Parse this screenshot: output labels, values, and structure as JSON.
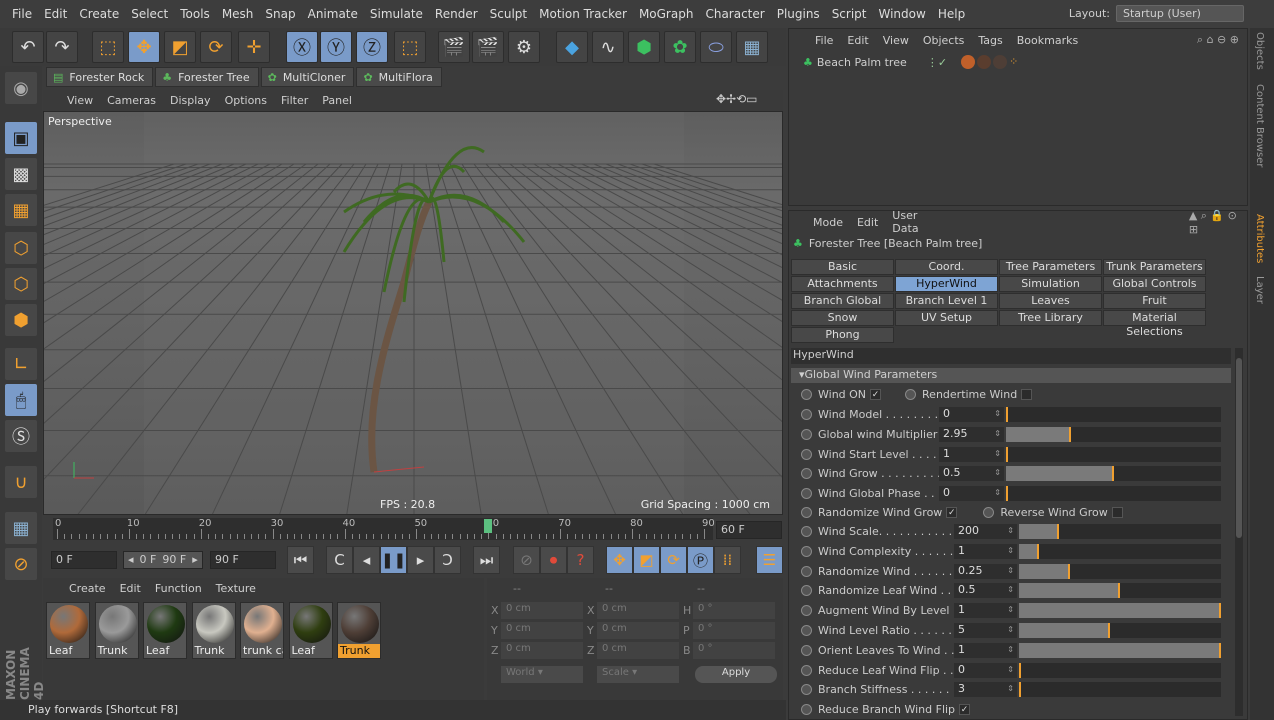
{
  "menubar": {
    "items": [
      "File",
      "Edit",
      "Create",
      "Select",
      "Tools",
      "Mesh",
      "Snap",
      "Animate",
      "Simulate",
      "Render",
      "Sculpt",
      "Motion Tracker",
      "MoGraph",
      "Character",
      "Plugins",
      "Script",
      "Window",
      "Help"
    ],
    "layout_label": "Layout:",
    "layout_value": "Startup (User)"
  },
  "object_tabs": [
    "Forester Rock",
    "Forester Tree",
    "MultiCloner",
    "MultiFlora"
  ],
  "viewport": {
    "menu": [
      "View",
      "Cameras",
      "Display",
      "Options",
      "Filter",
      "Panel"
    ],
    "camera": "Perspective",
    "fps": "FPS : 20.8",
    "grid_spacing": "Grid Spacing : 1000 cm"
  },
  "timeline": {
    "ticks": [
      "0",
      "10",
      "20",
      "30",
      "40",
      "50",
      "60",
      "70",
      "80",
      "90"
    ],
    "current_frame": 60,
    "end_field": "60 F"
  },
  "transport": {
    "start": "0 F",
    "range_min": "0 F",
    "range_max": "90 F",
    "end": "90 F"
  },
  "materials": {
    "menu": [
      "Create",
      "Edit",
      "Function",
      "Texture"
    ],
    "items": [
      {
        "label": "Leaf",
        "color": "#b06a3a"
      },
      {
        "label": "Trunk",
        "color": "#9a9a9a"
      },
      {
        "label": "Leaf",
        "color": "#1f3a12"
      },
      {
        "label": "Trunk",
        "color": "#c8c8c0"
      },
      {
        "label": "trunk ca",
        "color": "#e0b090"
      },
      {
        "label": "Leaf",
        "color": "#2f3e10"
      },
      {
        "label": "Trunk",
        "color": "#4e3e36",
        "selected": true
      }
    ]
  },
  "coords": {
    "headers": [
      "--",
      "--",
      "--"
    ],
    "rows": [
      [
        "X",
        "0 cm",
        "X",
        "0 cm",
        "H",
        "0 °"
      ],
      [
        "Y",
        "0 cm",
        "Y",
        "0 cm",
        "P",
        "0 °"
      ],
      [
        "Z",
        "0 cm",
        "Z",
        "0 cm",
        "B",
        "0 °"
      ]
    ],
    "world": "World",
    "scale": "Scale",
    "apply": "Apply"
  },
  "status": "Play forwards [Shortcut F8]",
  "objects": {
    "menu": [
      "File",
      "Edit",
      "View",
      "Objects",
      "Tags",
      "Bookmarks"
    ],
    "item": "Beach Palm tree"
  },
  "attributes": {
    "menu": [
      "Mode",
      "Edit",
      "User Data"
    ],
    "title": "Forester Tree [Beach Palm tree]",
    "tabs": [
      "Basic",
      "Coord.",
      "Tree Parameters",
      "Trunk Parameters",
      "Attachments",
      "HyperWind",
      "Simulation",
      "Global Controls",
      "Branch Global",
      "Branch Level 1",
      "Leaves",
      "Fruit",
      "Snow",
      "UV Setup",
      "Tree Library",
      "Material Selections",
      "Phong"
    ],
    "active_tab": "HyperWind",
    "section": "HyperWind",
    "group": "Global Wind Parameters",
    "checks": [
      {
        "a": "Wind ON",
        "a_on": true,
        "b": "Rendertime Wind",
        "b_on": false
      },
      {
        "a": "Randomize Wind Grow",
        "a_on": true,
        "b": "Reverse Wind Grow",
        "b_on": false
      },
      {
        "a": "Reduce Branch Wind Flip",
        "a_on": true
      }
    ],
    "params1": [
      {
        "label": "Wind Model . . . . . . . . .",
        "value": "0",
        "fill": 0
      },
      {
        "label": "Global wind Multiplier",
        "value": "2.95",
        "fill": 0.3
      },
      {
        "label": "Wind Start Level . . . . .",
        "value": "1",
        "fill": 0
      },
      {
        "label": "Wind Grow . . . . . . . . . .",
        "value": "0.5",
        "fill": 0.5
      },
      {
        "label": "Wind Global Phase . . .",
        "value": "0",
        "fill": 0
      }
    ],
    "params2": [
      {
        "label": "Wind Scale. . . . . . . . . . . .",
        "value": "200",
        "fill": 0.2
      },
      {
        "label": "Wind Complexity . . . . . . .",
        "value": "1",
        "fill": 0.1
      },
      {
        "label": "Randomize Wind . . . . . .",
        "value": "0.25",
        "fill": 0.25
      },
      {
        "label": "Randomize Leaf Wind . .",
        "value": "0.5",
        "fill": 0.5
      },
      {
        "label": "Augment Wind By Level",
        "value": "1",
        "fill": 1
      },
      {
        "label": "Wind Level Ratio . . . . . . .",
        "value": "5",
        "fill": 0.45
      },
      {
        "label": "Orient Leaves To Wind . .",
        "value": "1",
        "fill": 1
      },
      {
        "label": "Reduce Leaf Wind Flip . .",
        "value": "0",
        "fill": 0
      },
      {
        "label": "Branch Stiffness . . . . . . .",
        "value": "3",
        "fill": 0
      }
    ]
  },
  "side_tabs": [
    "Objects",
    "Content Browser",
    "Attributes",
    "Layer"
  ]
}
